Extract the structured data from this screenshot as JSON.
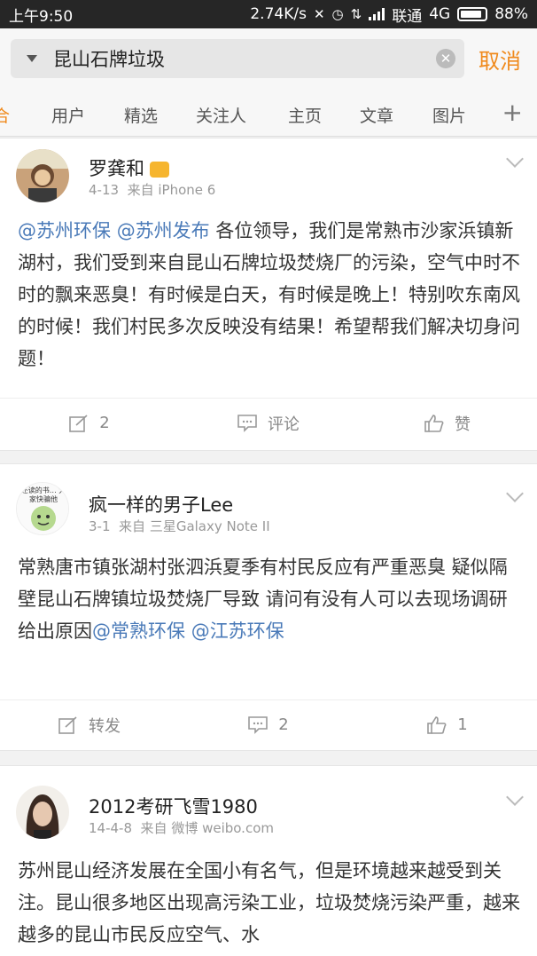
{
  "statusbar": {
    "time": "上午9:50",
    "speed": "2.74K/s",
    "carrier": "联通",
    "network": "4G",
    "battery": "88%",
    "battery_level": 0.88
  },
  "search": {
    "query": "昆山石牌垃圾",
    "cancel_label": "取消"
  },
  "tabs": {
    "items": [
      "合",
      "用户",
      "精选",
      "关注人",
      "主页",
      "文章",
      "图片"
    ],
    "more_icon": "plus-icon"
  },
  "posts": [
    {
      "author": "罗龚和",
      "date": "4-13",
      "source": "来自 iPhone 6",
      "body_mentions": [
        "@苏州环保",
        "@苏州发布"
      ],
      "body": "各位领导，我们是常熟市沙家浜镇新湖村，我们受到来自昆山石牌垃圾焚烧厂的污染，空气中时不时的飘来恶臭！有时候是白天，有时候是晚上！特别吹东南风的时候！我们村民多次反映没有结果！希望帮我们解决切身问题！",
      "actions": {
        "repost": "2",
        "comment": "评论",
        "like": "赞"
      }
    },
    {
      "author": "疯一样的男子Lee",
      "avatar_text": "还读的书… 大家快骗他",
      "date": "3-1",
      "source": "来自 三星Galaxy Note II",
      "body": "常熟唐市镇张湖村张泗浜夏季有村民反应有严重恶臭 疑似隔壁昆山石牌镇垃圾焚烧厂导致  请问有没有人可以去现场调研给出原因",
      "body_mentions": [
        "@常熟环保",
        "@江苏环保"
      ],
      "actions": {
        "repost": "转发",
        "comment": "2",
        "like": "1"
      }
    },
    {
      "author": "2012考研飞雪1980",
      "date": "14-4-8",
      "source": "来自 微博 weibo.com",
      "body": "苏州昆山经济发展在全国小有名气，但是环境越来越受到关注。昆山很多地区出现高污染工业，垃圾焚烧污染严重，越来越多的昆山市民反应空气、水"
    }
  ]
}
